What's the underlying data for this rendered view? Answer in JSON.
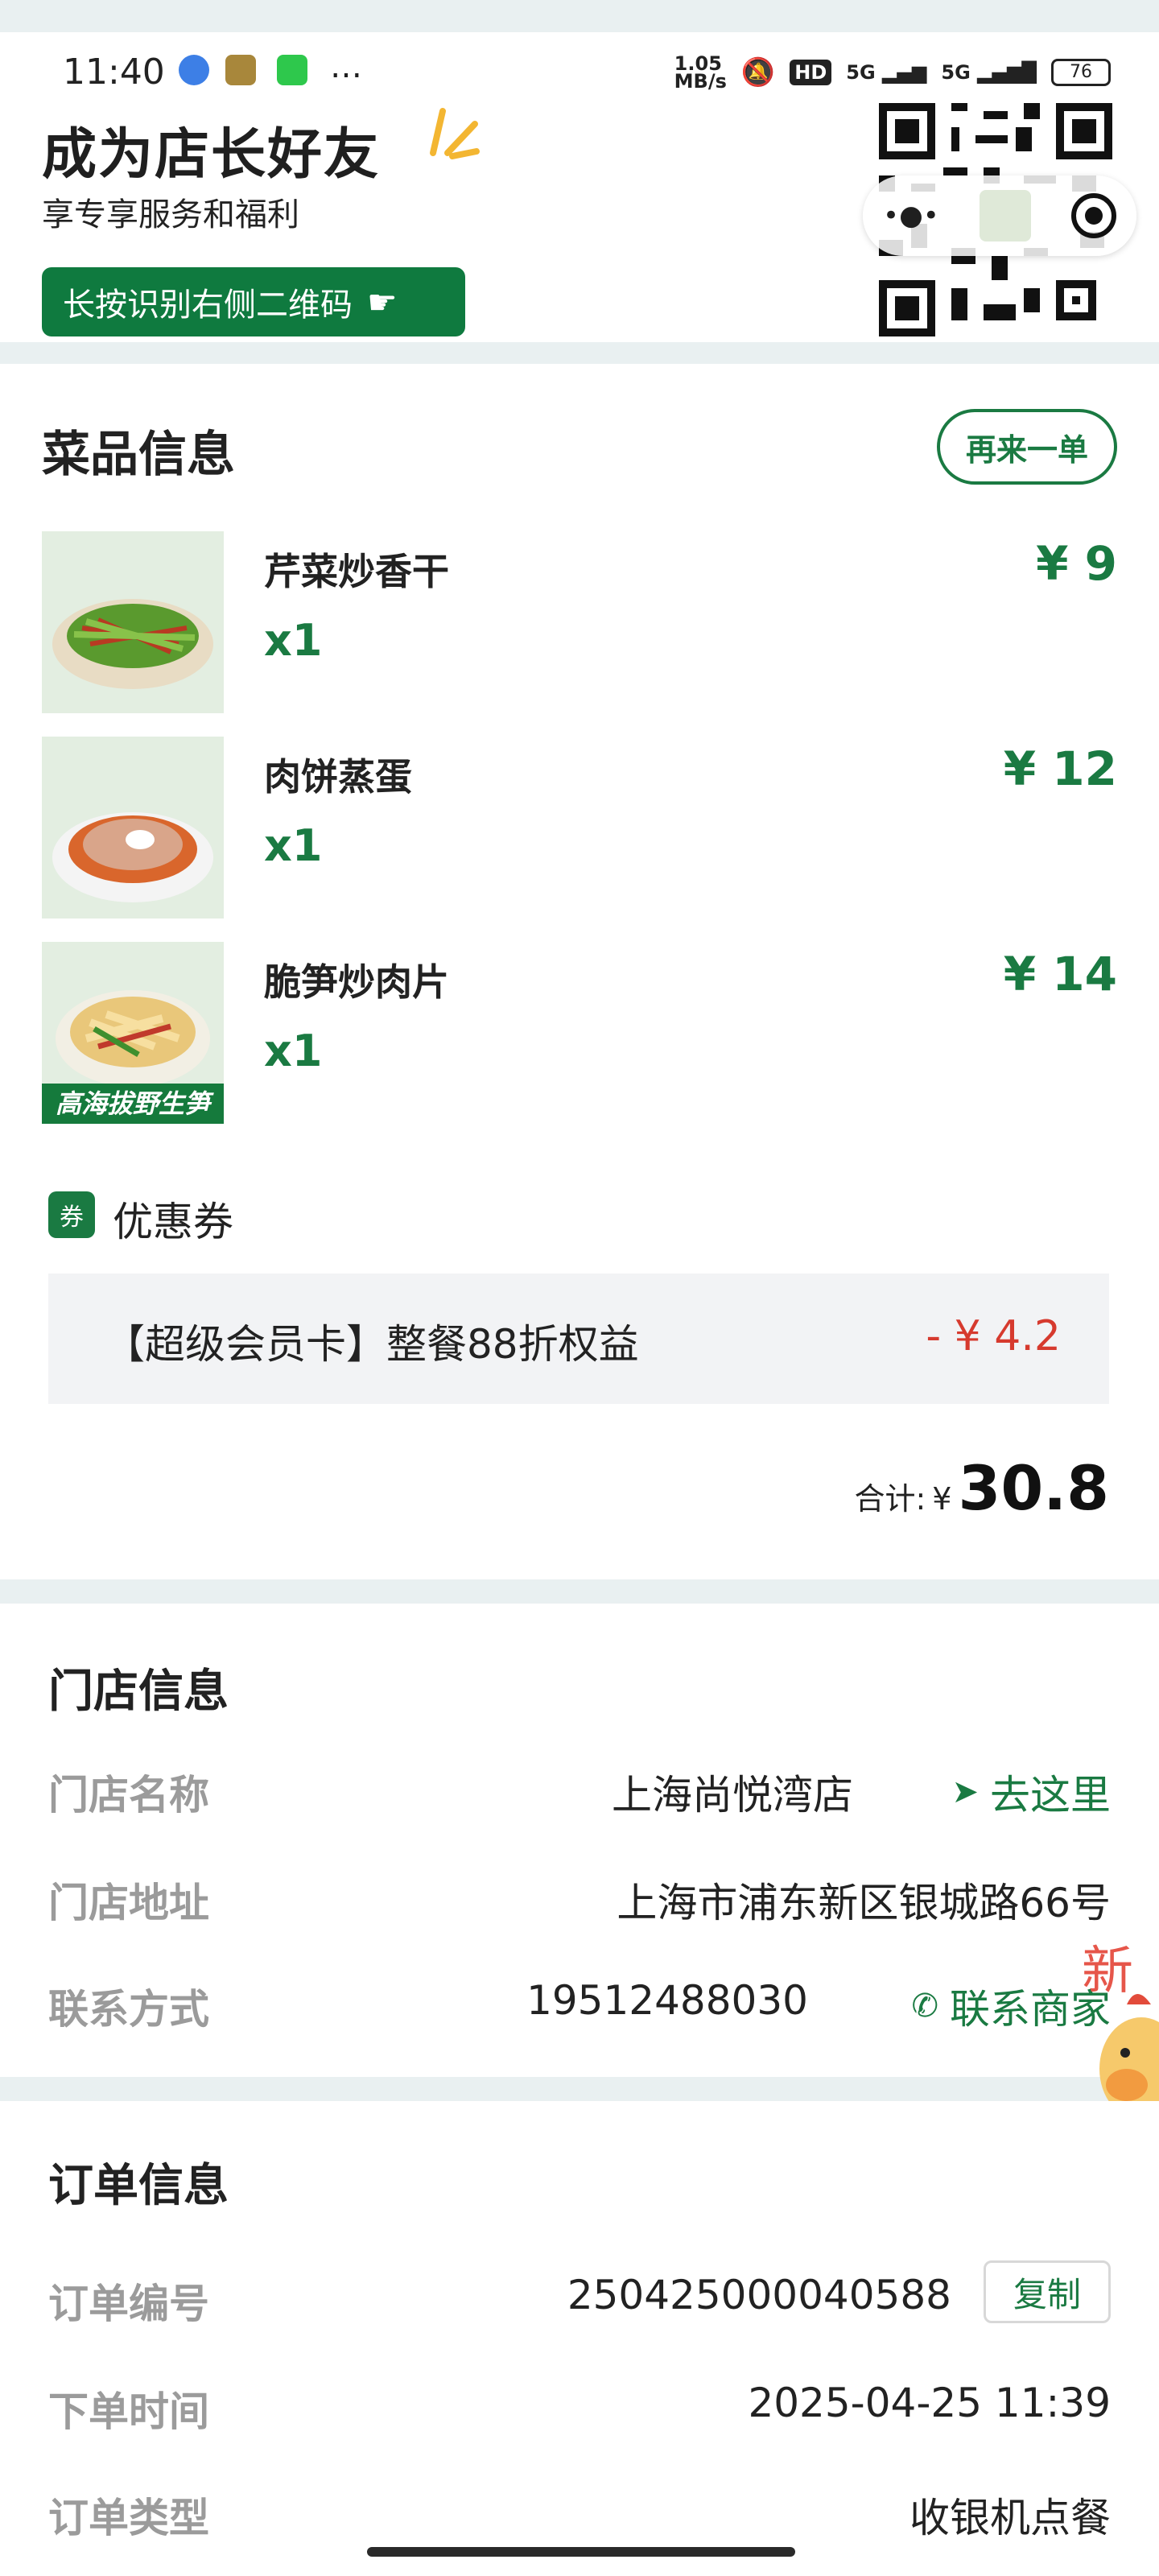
{
  "status_bar": {
    "time": "11:40",
    "speed_value": "1.05",
    "speed_unit": "MB/s",
    "net1": "5G",
    "net2": "5G",
    "battery": "76"
  },
  "promo": {
    "title": "成为店长好友",
    "subtitle": "享专享服务和福利",
    "button_label": "长按识别右侧二维码"
  },
  "dishes": {
    "section_title": "菜品信息",
    "reorder_label": "再来一单",
    "items": [
      {
        "name": "芹菜炒香干",
        "qty": "x1",
        "price": "¥ 9",
        "image_tag": ""
      },
      {
        "name": "肉饼蒸蛋",
        "qty": "x1",
        "price": "¥ 12",
        "image_tag": ""
      },
      {
        "name": "脆笋炒肉片",
        "qty": "x1",
        "price": "¥ 14",
        "image_tag": "高海拔野生笋"
      }
    ],
    "coupon_tag": "券",
    "coupon_title": "优惠券",
    "coupon_label": "【超级会员卡】整餐88折权益",
    "coupon_amount": "- ¥ 4.2",
    "total_label": "合计:",
    "total_currency": "¥",
    "total_value": "30.8"
  },
  "store": {
    "section_title": "门店信息",
    "name_key": "门店名称",
    "name_value": "上海尚悦湾店",
    "navigate_label": "去这里",
    "address_key": "门店地址",
    "address_value": "上海市浦东新区银城路66号",
    "contact_key": "联系方式",
    "contact_value": "19512488030",
    "contact_action": "联系商家"
  },
  "order": {
    "section_title": "订单信息",
    "number_key": "订单编号",
    "number_value": "250425000040588",
    "copy_label": "复制",
    "time_key": "下单时间",
    "time_value": "2025-04-25 11:39",
    "type_key": "订单类型",
    "type_value": "收银机点餐"
  },
  "colors": {
    "brand_green": "#1a7a42",
    "discount_red": "#d63a2e",
    "page_bg": "#e9f0f1"
  }
}
